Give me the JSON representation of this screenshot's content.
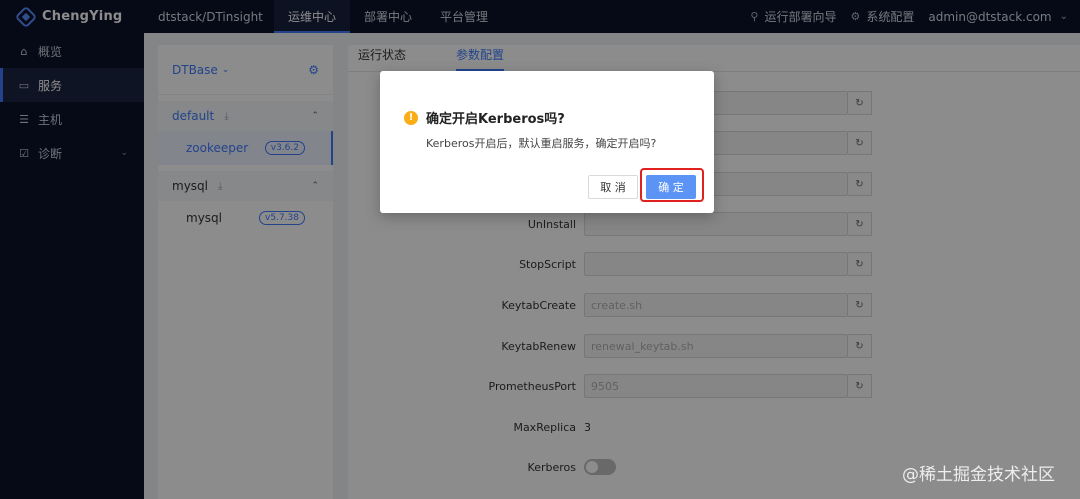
{
  "topbar": {
    "logo": "ChengYing",
    "cluster": "dtstack/DTinsight",
    "nav": [
      "运维中心",
      "部署中心",
      "平台管理"
    ],
    "deploy_guide": "运行部署向导",
    "system_config": "系统配置",
    "user": "admin@dtstack.com"
  },
  "sidebar": {
    "items": [
      "概览",
      "服务",
      "主机",
      "诊断"
    ]
  },
  "services": {
    "product": "DTBase",
    "groups": [
      {
        "name": "default",
        "service": "zookeeper",
        "version": "v3.6.2"
      },
      {
        "name": "mysql",
        "service": "mysql",
        "version": "v5.7.38"
      }
    ]
  },
  "main": {
    "tabs": [
      "运行状态",
      "参数配置"
    ],
    "fields": [
      {
        "label": "UnInstall",
        "value": ""
      },
      {
        "label": "StopScript",
        "value": ""
      },
      {
        "label": "KeytabCreate",
        "value": "create.sh"
      },
      {
        "label": "KeytabRenew",
        "value": "renewal_keytab.sh"
      },
      {
        "label": "PrometheusPort",
        "value": "9505"
      }
    ],
    "max_replica_label": "MaxReplica",
    "max_replica_value": "3",
    "kerberos_label": "Kerberos"
  },
  "modal": {
    "title": "确定开启Kerberos吗?",
    "body": "Kerberos开启后，默认重启服务，确定开启吗?",
    "cancel": "取 消",
    "ok": "确 定"
  },
  "watermark": "@稀土掘金技术社区"
}
